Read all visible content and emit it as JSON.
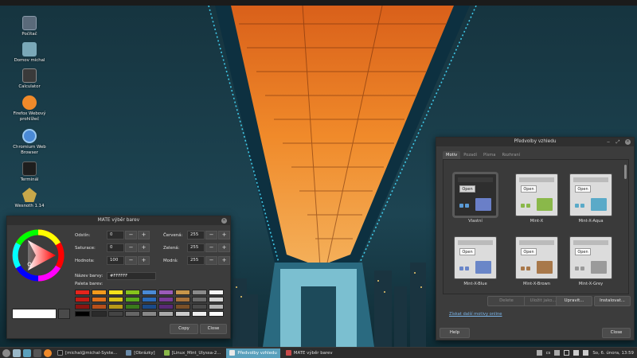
{
  "desktop": {
    "icons": [
      {
        "label": "Počítač",
        "icon": "computer-icon"
      },
      {
        "label": "Domov michal",
        "icon": "home-folder-icon"
      },
      {
        "label": "Calculator",
        "icon": "calculator-icon"
      },
      {
        "label": "Firefox Webový prohlížeč",
        "icon": "firefox-icon"
      },
      {
        "label": "Chromium Web Browser",
        "icon": "chromium-icon"
      },
      {
        "label": "Terminál",
        "icon": "terminal-icon"
      },
      {
        "label": "Wesnoth 1.14",
        "icon": "wesnoth-icon"
      }
    ]
  },
  "color_picker": {
    "title": "MATE výběr barev",
    "hue_label": "Odstín:",
    "hue_value": "0",
    "saturation_label": "Saturace:",
    "saturation_value": "0",
    "value_label": "Hodnota:",
    "value_value": "100",
    "red_label": "Červená:",
    "red_value": "255",
    "green_label": "Zelená:",
    "green_value": "255",
    "blue_label": "Modrá:",
    "blue_value": "255",
    "color_name_label": "Název barvy:",
    "color_name_value": "#FFFFFF",
    "palette_label": "Paleta barev:",
    "minus": "−",
    "plus": "+",
    "copy_button": "Copy",
    "close_button": "Close",
    "current_color": "#ffffff",
    "palette": [
      [
        "#e6241c",
        "#f39a1c",
        "#f4e21c",
        "#86c21c",
        "#4a8ad6",
        "#9a5bb8",
        "#c8964a",
        "#8a8a8a",
        "#f4f4f4"
      ],
      [
        "#c41a14",
        "#e0701a",
        "#d8c218",
        "#5aa81c",
        "#2a6ab8",
        "#7a3a98",
        "#a8723a",
        "#6a6a6a",
        "#d4d4d4"
      ],
      [
        "#8a1410",
        "#b8501a",
        "#b89a18",
        "#3a7a1c",
        "#1a4a88",
        "#5a2a78",
        "#7a5028",
        "#4a4a4a",
        "#b4b4b4"
      ],
      [
        "#000000",
        "#2a2a2a",
        "#444444",
        "#666666",
        "#888888",
        "#aaaaaa",
        "#cccccc",
        "#eeeeee",
        "#ffffff"
      ]
    ]
  },
  "themes_window": {
    "title": "Předvolby vzhledu",
    "tabs": [
      "Motiv",
      "Pozadí",
      "Písma",
      "Rozhraní"
    ],
    "themes": [
      {
        "name": "Vlastní",
        "folder": "#6a7fc8"
      },
      {
        "name": "Mint-X",
        "folder": "#8ab84a"
      },
      {
        "name": "Mint-X-Aqua",
        "folder": "#5aaac8"
      },
      {
        "name": "Mint-X-Blue",
        "folder": "#6a86c8"
      },
      {
        "name": "Mint-X-Brown",
        "folder": "#a8784a"
      },
      {
        "name": "Mint-X-Grey",
        "folder": "#9a9a9a"
      }
    ],
    "open_label": "Open",
    "delete_button": "Delete",
    "save_as_button": "Uložit jako...",
    "customize_button": "Upravit...",
    "install_button": "Instalovat...",
    "more_themes_link": "Získat další motivy online",
    "help_button": "Help",
    "close_button": "Close"
  },
  "taskbar": {
    "tasks": [
      {
        "label": "[michal@michal-Syste...",
        "active": false
      },
      {
        "label": "[Obrázky]",
        "active": false
      },
      {
        "label": "[Linux_Mint_Ulyssa-2...",
        "active": false
      },
      {
        "label": "Předvolby vzhledu",
        "active": true
      },
      {
        "label": "MATE výběr barev",
        "active": false
      }
    ],
    "tray_lang": "cs",
    "clock": "So, 6. února, 13:59"
  }
}
